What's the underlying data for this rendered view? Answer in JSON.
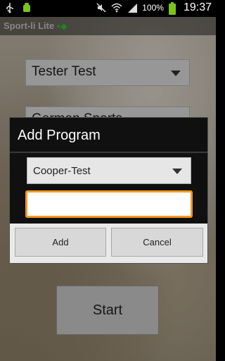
{
  "status_bar": {
    "battery_text": "100%",
    "time": "19:37",
    "icons": [
      "usb-icon",
      "android-notification-icon",
      "mute-icon",
      "wifi-icon",
      "signal-icon",
      "battery-icon"
    ]
  },
  "app": {
    "title": "Sport-li Lite",
    "title_mark": "+◆"
  },
  "background_form": {
    "spinner1_value": "Tester Test",
    "spinner2_value": "German Sports",
    "start_label": "Start"
  },
  "dialog": {
    "title": "Add Program",
    "program_spinner_value": "Cooper-Test",
    "input_value": "",
    "input_placeholder": "",
    "add_label": "Add",
    "cancel_label": "Cancel"
  }
}
